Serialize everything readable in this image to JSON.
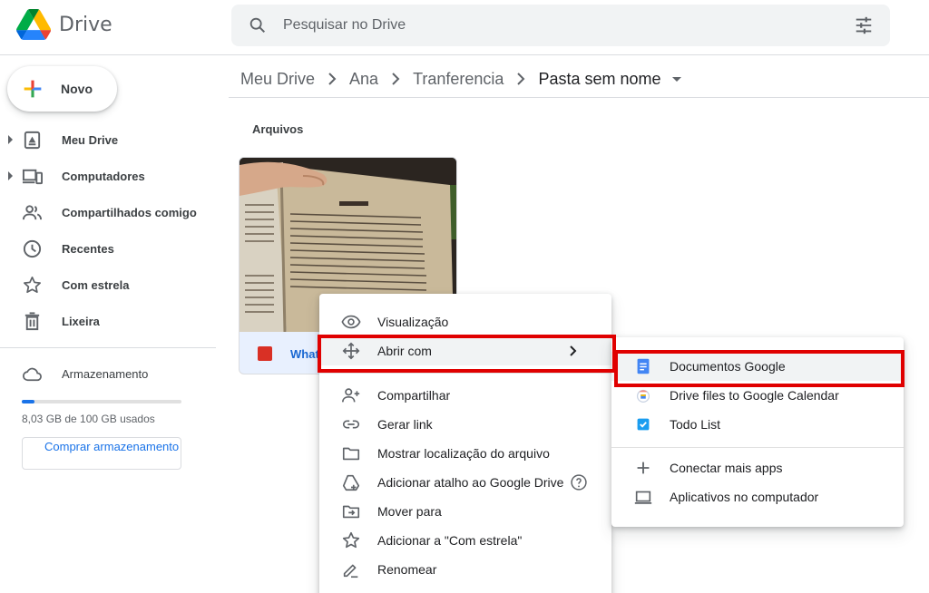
{
  "app": {
    "name": "Drive"
  },
  "search": {
    "placeholder": "Pesquisar no Drive"
  },
  "sidebar": {
    "new_label": "Novo",
    "items": [
      {
        "label": "Meu Drive",
        "icon": "my-drive-icon",
        "expandable": true
      },
      {
        "label": "Computadores",
        "icon": "computers-icon",
        "expandable": true
      },
      {
        "label": "Compartilhados comigo",
        "icon": "shared-icon",
        "expandable": false
      },
      {
        "label": "Recentes",
        "icon": "clock-icon",
        "expandable": false
      },
      {
        "label": "Com estrela",
        "icon": "star-icon",
        "expandable": false
      },
      {
        "label": "Lixeira",
        "icon": "trash-icon",
        "expandable": false
      }
    ],
    "storage": {
      "label": "Armazenamento",
      "used_text": "8,03 GB de 100 GB usados",
      "used_fraction": 0.08,
      "buy_label": "Comprar armazenamento"
    }
  },
  "breadcrumb": [
    "Meu Drive",
    "Ana",
    "Tranferencia",
    "Pasta sem nome"
  ],
  "section": {
    "files_title": "Arquivos"
  },
  "file": {
    "name_visible": "What",
    "icon": "image-file-icon"
  },
  "context_menu": {
    "items": [
      {
        "label": "Visualização",
        "icon": "eye-icon"
      },
      {
        "label": "Abrir com",
        "icon": "move-arrows-icon",
        "has_submenu": true,
        "highlighted": true
      },
      {
        "label": "Compartilhar",
        "icon": "person-add-icon"
      },
      {
        "label": "Gerar link",
        "icon": "link-icon"
      },
      {
        "label": "Mostrar localização do arquivo",
        "icon": "folder-icon"
      },
      {
        "label": "Adicionar atalho ao Google Drive",
        "icon": "add-shortcut-icon",
        "help": true
      },
      {
        "label": "Mover para",
        "icon": "move-to-icon"
      },
      {
        "label": "Adicionar a \"Com estrela\"",
        "icon": "star-outline-icon"
      },
      {
        "label": "Renomear",
        "icon": "pencil-icon"
      }
    ]
  },
  "submenu": {
    "items": [
      {
        "label": "Documentos Google",
        "icon": "google-docs-icon",
        "highlighted": true
      },
      {
        "label": "Drive files to Google Calendar",
        "icon": "calendar-app-icon"
      },
      {
        "label": "Todo List",
        "icon": "checkbox-app-icon"
      },
      {
        "label": "Conectar mais apps",
        "icon": "plus-icon"
      },
      {
        "label": "Aplicativos no computador",
        "icon": "laptop-icon"
      }
    ]
  },
  "colors": {
    "accent": "#1a73e8",
    "highlight_box": "#e00000",
    "menu_hover": "#f1f3f4"
  }
}
